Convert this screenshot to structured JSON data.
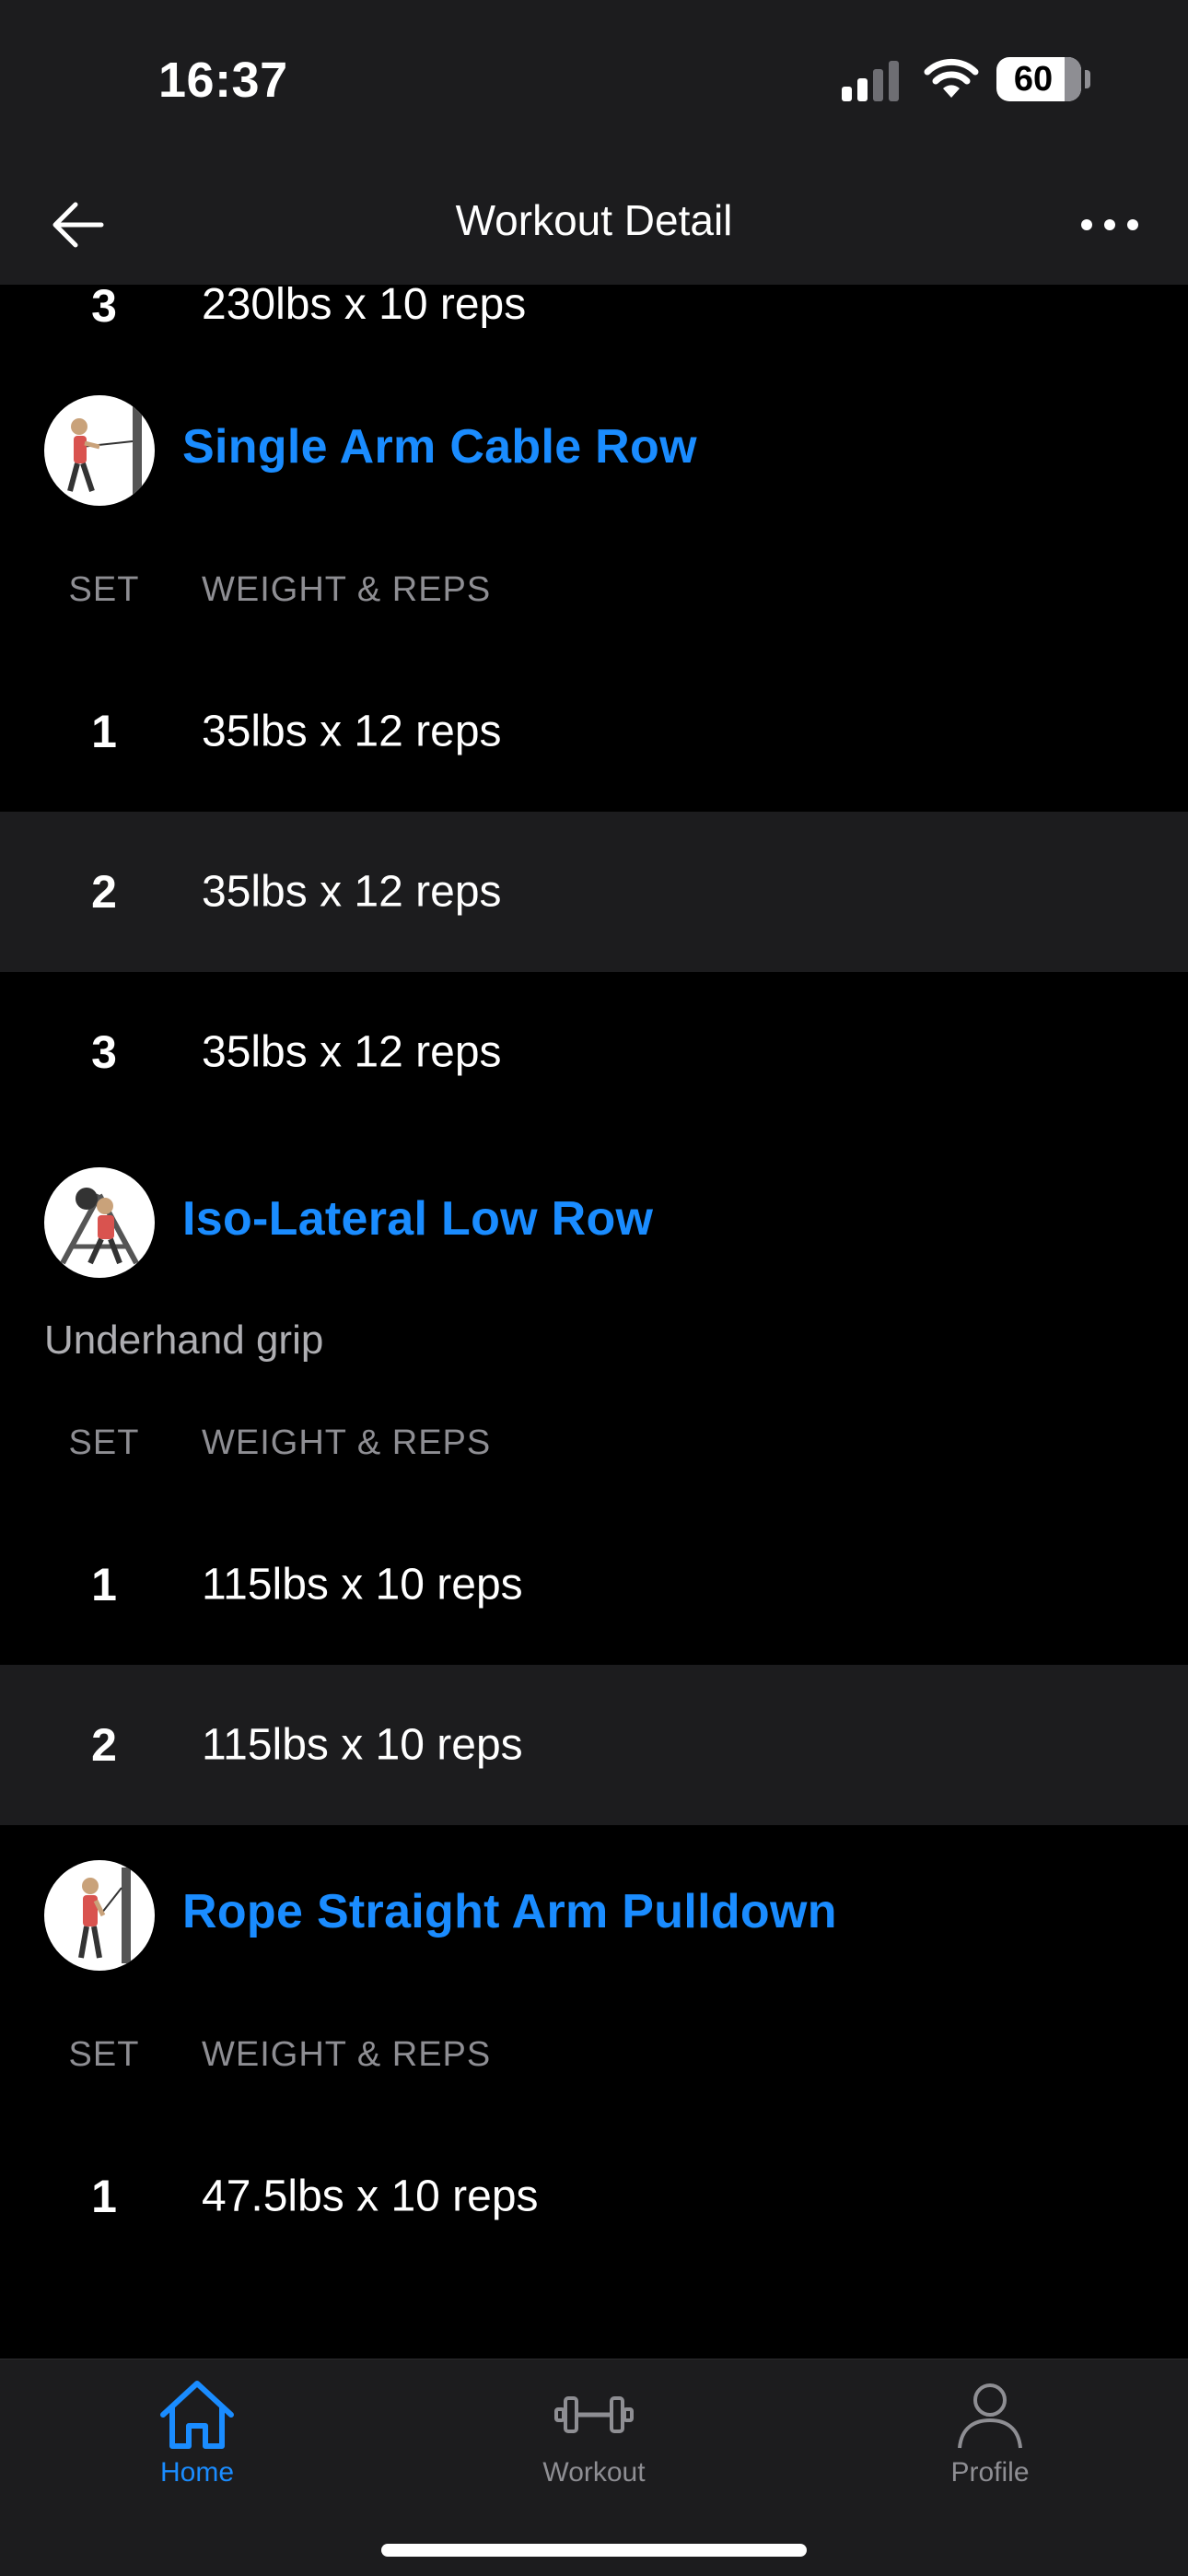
{
  "status_bar": {
    "time": "16:37",
    "battery": "60"
  },
  "header": {
    "title": "Workout Detail",
    "back_icon": "arrow-left-icon",
    "more_icon": "ellipsis-icon"
  },
  "top_partial_set": {
    "set": "3",
    "weight_reps": "230lbs x 10 reps"
  },
  "column_headers": {
    "set": "SET",
    "weight_reps": "WEIGHT & REPS"
  },
  "exercises": [
    {
      "name": "Single Arm Cable Row",
      "note": "",
      "sets": [
        {
          "set": "1",
          "weight_reps": "35lbs x 12 reps"
        },
        {
          "set": "2",
          "weight_reps": "35lbs x 12 reps"
        },
        {
          "set": "3",
          "weight_reps": "35lbs x 12 reps"
        }
      ]
    },
    {
      "name": "Iso-Lateral Low Row",
      "note": "Underhand grip",
      "sets": [
        {
          "set": "1",
          "weight_reps": "115lbs x 10 reps"
        },
        {
          "set": "2",
          "weight_reps": "115lbs x 10 reps"
        }
      ]
    },
    {
      "name": "Rope Straight Arm Pulldown",
      "note": "",
      "sets": [
        {
          "set": "1",
          "weight_reps": "47.5lbs x 10 reps"
        }
      ]
    }
  ],
  "tabbar": {
    "home": "Home",
    "workout": "Workout",
    "profile": "Profile",
    "active": "home"
  },
  "colors": {
    "accent": "#1a8cff",
    "background": "#000000",
    "surface": "#1c1c1e",
    "muted": "#8e8e93"
  }
}
